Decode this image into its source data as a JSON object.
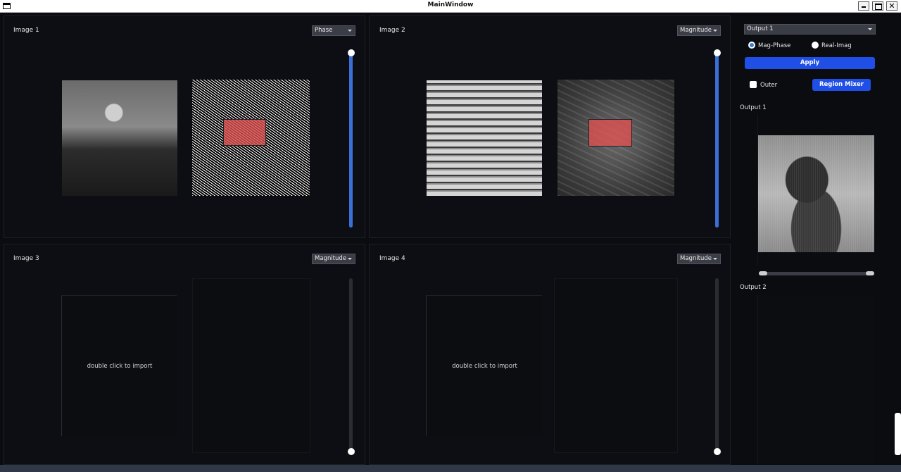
{
  "window": {
    "title": "MainWindow"
  },
  "panels": [
    {
      "label": "Image 1",
      "mode": "Phase",
      "slider_value": 1.0
    },
    {
      "label": "Image 2",
      "mode": "Magnitude",
      "slider_value": 1.0
    },
    {
      "label": "Image 3",
      "mode": "Magnitude",
      "slider_value": 0.0,
      "hint": "double click to import"
    },
    {
      "label": "Image 4",
      "mode": "Magnitude",
      "slider_value": 0.0,
      "hint": "double click to import"
    }
  ],
  "controls": {
    "output_select": "Output 1",
    "radio_mag_phase": "Mag-Phase",
    "radio_real_imag": "Real-Imag",
    "selected_mode": "Mag-Phase",
    "apply_label": "Apply",
    "outer_label": "Outer",
    "region_mixer_label": "Region Mixer"
  },
  "outputs": [
    {
      "label": "Output 1"
    },
    {
      "label": "Output 2"
    }
  ],
  "colors": {
    "accent": "#1f4fe6",
    "slider_fill": "#3b6fd8",
    "region": "#e05050",
    "background": "#0b0c10"
  }
}
